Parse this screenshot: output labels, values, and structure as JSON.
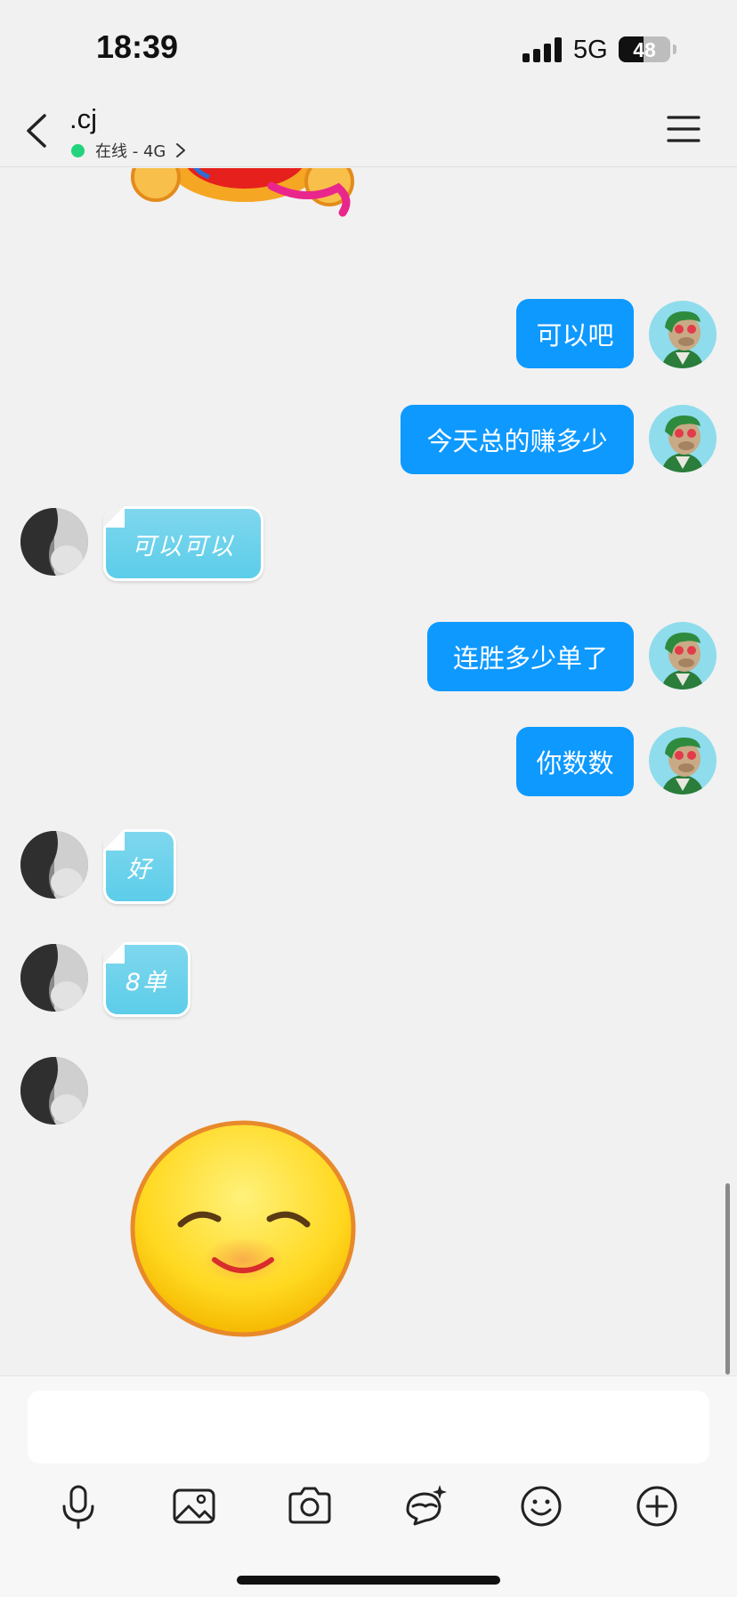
{
  "status_bar": {
    "time": "18:39",
    "network": "5G",
    "battery": "48",
    "battery_level": 0.48
  },
  "header": {
    "title": ".cj",
    "status": "在线 - 4G",
    "online_color": "#22d37c"
  },
  "messages": [
    {
      "side": "right",
      "type": "text",
      "text": "可以吧"
    },
    {
      "side": "right",
      "type": "text",
      "text": "今天总的赚多少"
    },
    {
      "side": "left",
      "type": "text",
      "text": "可以可以"
    },
    {
      "side": "right",
      "type": "text",
      "text": "连胜多少单了"
    },
    {
      "side": "right",
      "type": "text",
      "text": "你数数"
    },
    {
      "side": "left",
      "type": "text",
      "text": "好"
    },
    {
      "side": "left",
      "type": "text",
      "text": "8单"
    },
    {
      "side": "left",
      "type": "sticker",
      "sticker": "smiling-emoji"
    }
  ],
  "input": {
    "placeholder": ""
  },
  "toolbar": [
    "microphone-icon",
    "image-icon",
    "camera-icon",
    "ai-assistant-icon",
    "emoji-icon",
    "plus-icon"
  ],
  "colors": {
    "outgoing_bubble": "#0e99ff",
    "incoming_bubble": "#5ccde9",
    "background": "#f1f1f1"
  }
}
